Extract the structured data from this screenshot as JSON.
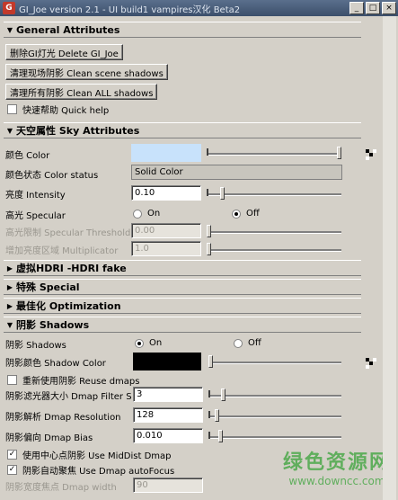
{
  "window": {
    "title": "GI_Joe version 2.1 - UI build1 vampires汉化 Beta2",
    "controls": {
      "minimize": "_",
      "maximize": "□",
      "close": "×"
    }
  },
  "general": {
    "header": "General Attributes",
    "delete_button": "删除GI灯光 Delete GI_Joe",
    "clear_scene_button": "清理现场阴影 Clean scene shadows",
    "clear_all_button": "清理所有阴影 Clean ALL shadows",
    "quick_help_label": "快速帮助 Quick help",
    "quick_help_checked": false
  },
  "sky": {
    "header": "天空属性 Sky Attributes",
    "color_label": "颜色 Color",
    "color_value": "#c8e2fb",
    "color_level": 1.0,
    "color_status_label": "颜色状态 Color status",
    "color_status_value": "Solid Color",
    "intensity_label": "亮度 Intensity",
    "intensity_value": "0.10",
    "intensity_level": 0.1,
    "specular_label": "高光 Specular",
    "specular_on": "On",
    "specular_off": "Off",
    "specular_selected": "off",
    "specular_threshold_label": "高光限制 Specular Threshold",
    "specular_threshold_value": "0.00",
    "specular_threshold_level": 0.0,
    "multiplicator_label": "增加亮度区域 Multiplicator",
    "multiplicator_value": "1.0",
    "multiplicator_level": 0.0
  },
  "collapsed_sections": {
    "hdri": "虚拟HDRI -HDRI fake",
    "special": "特殊 Special",
    "optimization": "最佳化 Optimization"
  },
  "shadows": {
    "header": "阴影 Shadows",
    "shadows_label": "阴影 Shadows",
    "on_label": "On",
    "off_label": "Off",
    "selected": "on",
    "shadow_color_label": "阴影颜色 Shadow Color",
    "shadow_color_value": "#000000",
    "shadow_color_level": 0.0,
    "reuse_dmaps_label": "重新使用阴影 Reuse dmaps",
    "reuse_dmaps_checked": false,
    "dmap_filter_label": "阴影滤光器大小 Dmap Filter Size",
    "dmap_filter_value": "3",
    "dmap_filter_level": 0.1,
    "dmap_resolution_label": "阴影解析 Dmap Resolution",
    "dmap_resolution_value": "128",
    "dmap_resolution_level": 0.05,
    "dmap_bias_label": "阴影偏向 Dmap Bias",
    "dmap_bias_value": "0.010",
    "dmap_bias_level": 0.08,
    "middist_label": "使用中心点阴影 Use MidDist Dmap",
    "middist_checked": true,
    "autofocus_label": "阴影自动聚焦 Use Dmap autoFocus",
    "autofocus_checked": true,
    "dmap_width_label": "阴影宽度焦点 Dmap width",
    "dmap_width_value": "90"
  },
  "watermark": {
    "line1": "绿色资源网",
    "line2": "www.downcc.com"
  }
}
